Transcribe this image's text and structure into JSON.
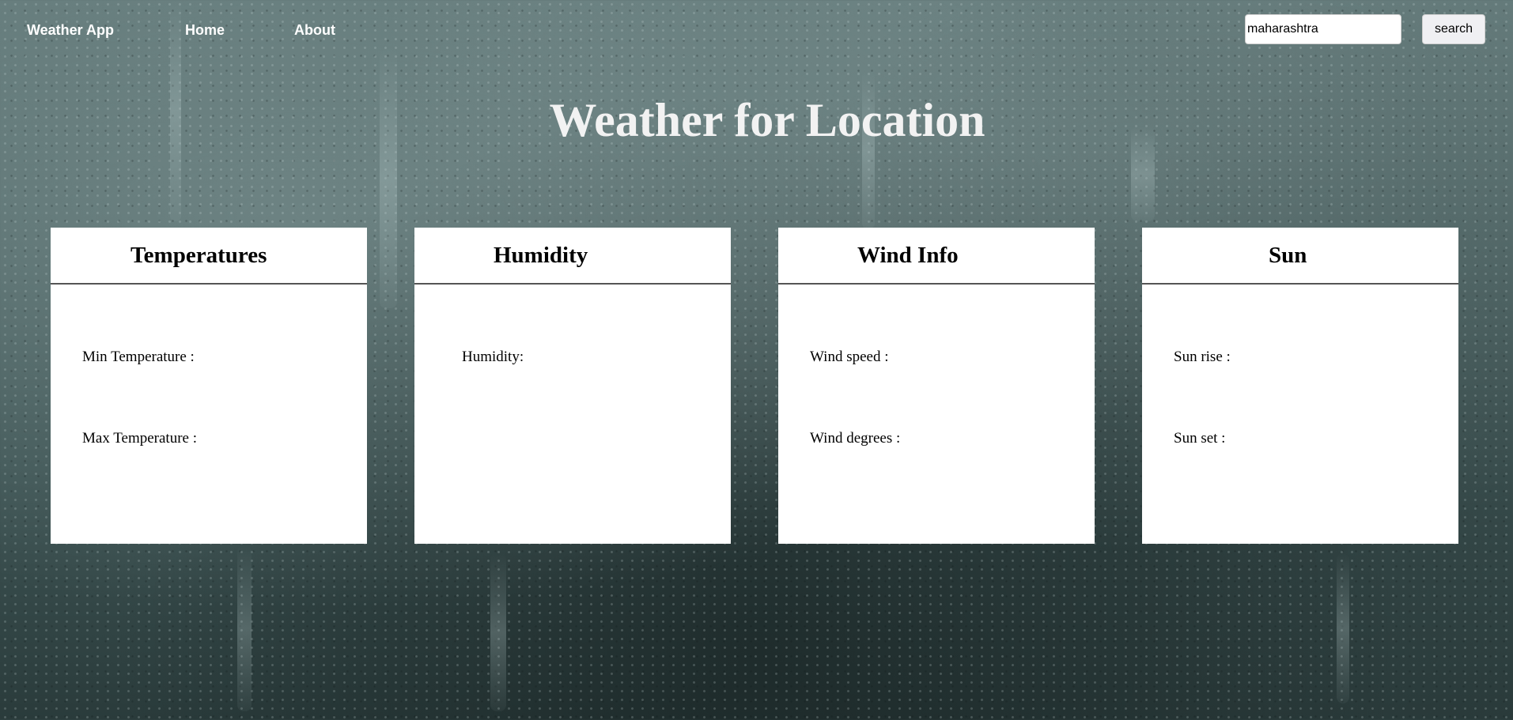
{
  "nav": {
    "brand": "Weather App",
    "links": [
      "Home",
      "About"
    ]
  },
  "search": {
    "value": "maharashtra",
    "button_label": "search"
  },
  "page_title": "Weather for Location",
  "cards": [
    {
      "title": "Temperatures",
      "lines": [
        "Min Temperature :",
        "Max Temperature :"
      ]
    },
    {
      "title": "Humidity",
      "lines": [
        "Humidity:"
      ]
    },
    {
      "title": "Wind Info",
      "lines": [
        "Wind speed :",
        "Wind degrees :"
      ]
    },
    {
      "title": "Sun",
      "lines": [
        "Sun rise :",
        "Sun set :"
      ]
    }
  ]
}
